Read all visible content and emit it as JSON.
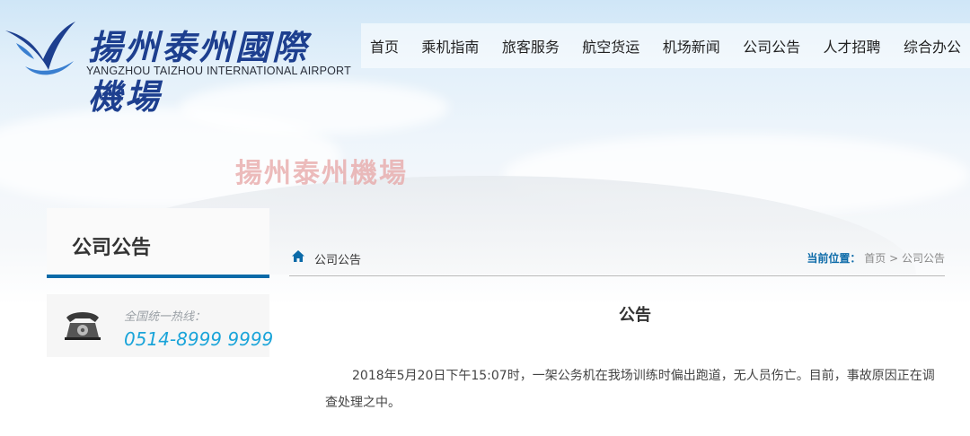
{
  "header": {
    "logo_cn": "揚州泰州國際機場",
    "logo_en": "YANGZHOU TAIZHOU INTERNATIONAL AIRPORT",
    "nav": [
      "首页",
      "乘机指南",
      "旅客服务",
      "航空货运",
      "机场新闻",
      "公司公告",
      "人才招聘",
      "综合办公"
    ]
  },
  "banner": {
    "sign_text": "揚州泰州機場"
  },
  "sidebar": {
    "title": "公司公告",
    "hotline_label": "全国统一热线：",
    "hotline_number": "0514-8999 9999"
  },
  "main": {
    "section_title": "公司公告",
    "breadcrumb_label": "当前位置：",
    "breadcrumb_home": "首页",
    "breadcrumb_sep": ">",
    "breadcrumb_current": "公司公告",
    "article_title": "公告",
    "article_body": "2018年5月20日下午15:07时，一架公务机在我场训练时偏出跑道，无人员伤亡。目前，事故原因正在调查处理之中。"
  },
  "colors": {
    "accent": "#0b6aa8",
    "hotline": "#1aa4d9",
    "logo": "#1d3f8f"
  },
  "icons": {
    "home": "home-icon",
    "phone": "telephone-icon",
    "logo": "airport-logo-icon"
  }
}
